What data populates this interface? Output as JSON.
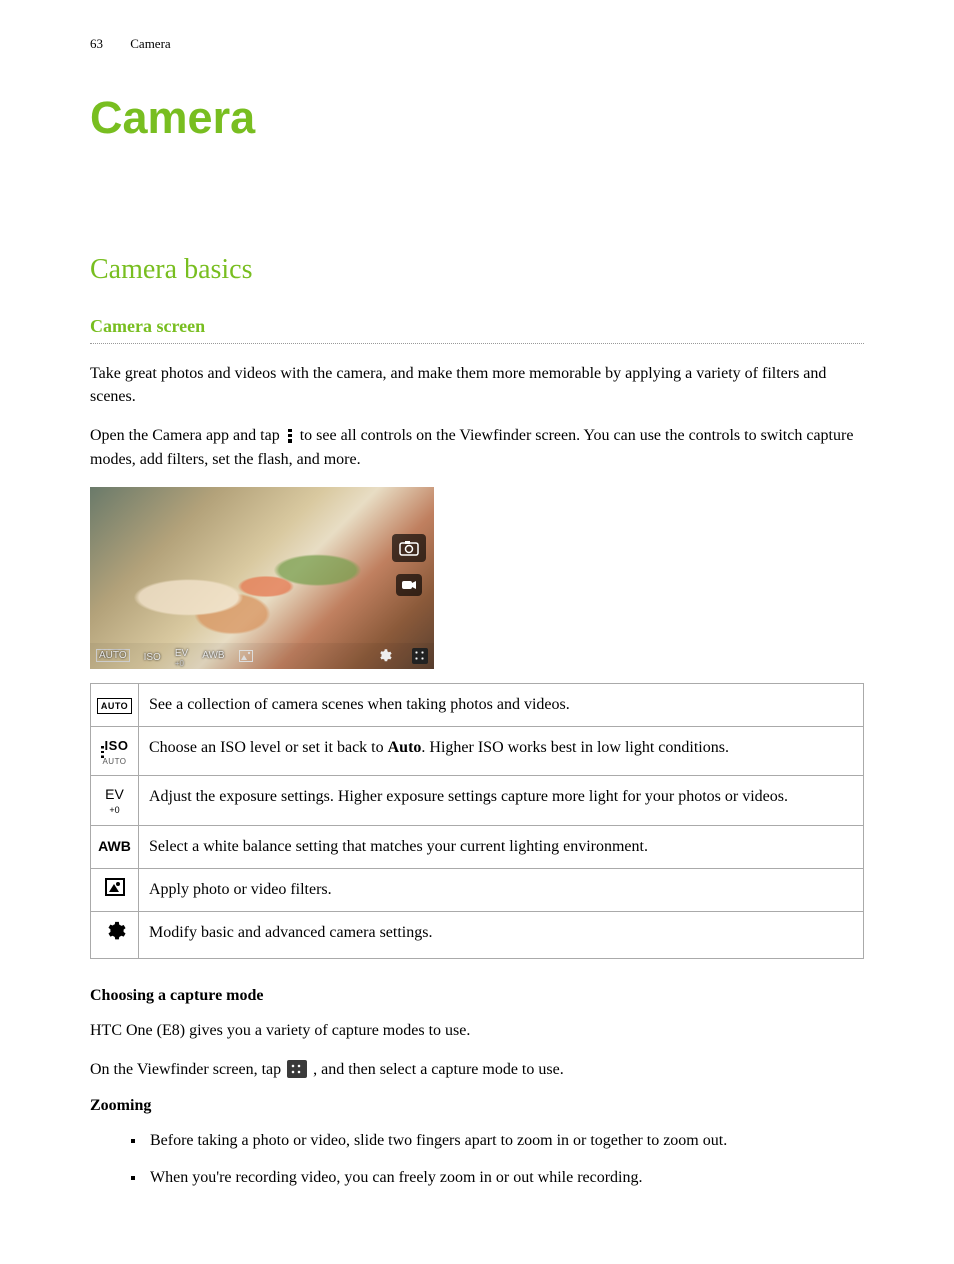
{
  "header": {
    "page_number": "63",
    "section": "Camera"
  },
  "chapter_title": "Camera",
  "section_title": "Camera basics",
  "subsection_title": "Camera screen",
  "intro_p1": "Take great photos and videos with the camera, and make them more memorable by applying a variety of filters and scenes.",
  "intro_p2_a": "Open the Camera app and tap ",
  "intro_p2_b": " to see all controls on the Viewfinder screen. You can use the controls to switch capture modes, add filters, set the flash, and more.",
  "viewfinder": {
    "bottom_labels": {
      "scene": "AUTO",
      "iso": "ISO",
      "ev": "EV",
      "ev_sub": "+0",
      "awb": "AWB"
    }
  },
  "icon_table": {
    "rows": [
      {
        "icon": "auto",
        "text_a": "See a collection of camera scenes when taking photos and videos.",
        "bold": "",
        "text_b": ""
      },
      {
        "icon": "iso",
        "text_a": "Choose an ISO level or set it back to ",
        "bold": "Auto",
        "text_b": ". Higher ISO works best in low light conditions."
      },
      {
        "icon": "ev",
        "text_a": "Adjust the exposure settings. Higher exposure settings capture more light for your photos or videos.",
        "bold": "",
        "text_b": ""
      },
      {
        "icon": "awb",
        "text_a": "Select a white balance setting that matches your current lighting environment.",
        "bold": "",
        "text_b": ""
      },
      {
        "icon": "filter",
        "text_a": "Apply photo or video filters.",
        "bold": "",
        "text_b": ""
      },
      {
        "icon": "gear",
        "text_a": "Modify basic and advanced camera settings.",
        "bold": "",
        "text_b": ""
      }
    ],
    "labels": {
      "auto": "AUTO",
      "iso": "ISO",
      "iso_sub": "AUTO",
      "ev": "EV",
      "ev_sub": "+0",
      "awb": "AWB"
    }
  },
  "capture_mode": {
    "heading": "Choosing a capture mode",
    "p1": "HTC One (E8) gives you you a variety of capture modes to use.",
    "p1_fixed": "HTC One (E8) gives you a variety of capture modes to use.",
    "p2_a": "On the Viewfinder screen, tap ",
    "p2_b": ", and then select a capture mode to use."
  },
  "zooming": {
    "heading": "Zooming",
    "bullets": [
      "Before taking a photo or video, slide two fingers apart to zoom in or together to zoom out.",
      "When you're recording video, you can freely zoom in or out while recording."
    ]
  }
}
